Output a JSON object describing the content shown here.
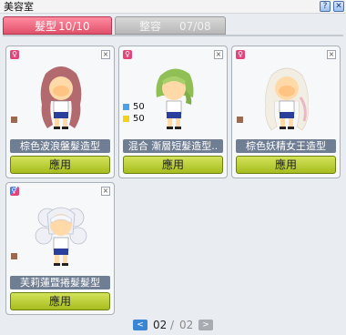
{
  "window": {
    "title": "美容室",
    "help_label": "?",
    "close_label": "✕"
  },
  "tabs": [
    {
      "label": "髮型",
      "count": "10/10",
      "active": true
    },
    {
      "label": "整容",
      "count": "07/08",
      "active": false
    }
  ],
  "cards": [
    {
      "name": "棕色波浪盤髮造型",
      "apply_label": "應用",
      "gender": "♀",
      "color_swatch": "#9b6a52",
      "hair_color": "#b36a6e"
    },
    {
      "name": "混合 漸層短髮造型..",
      "apply_label": "應用",
      "gender": "♀",
      "hair_color": "#8fbf55",
      "mix": [
        {
          "color": "#4aa3e8",
          "value": "50"
        },
        {
          "color": "#f2d21a",
          "value": "50"
        }
      ]
    },
    {
      "name": "棕色妖精女王造型",
      "apply_label": "應用",
      "gender": "♀",
      "color_swatch": "#9b6a52",
      "hair_color": "#f3eee4"
    },
    {
      "name": "芙莉蓮暨捲髮髮型",
      "apply_label": "應用",
      "gender": "⚥",
      "color_swatch": "#9b6a52",
      "hair_color": "#eef0f6"
    }
  ],
  "pager": {
    "prev_label": "<",
    "next_label": ">",
    "current": "02",
    "separator": "/",
    "total": "02"
  }
}
